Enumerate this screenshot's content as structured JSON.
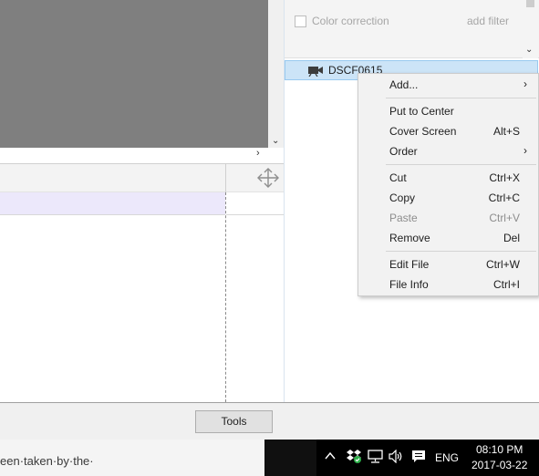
{
  "filters": {
    "items": [
      {
        "label": "Color correction",
        "checked": false
      }
    ],
    "add_filter_label": "add filter"
  },
  "clip": {
    "name": "DSCF0615",
    "icon": "video-camera-icon"
  },
  "context_menu": {
    "items": [
      {
        "label": "Add...",
        "submenu": true
      },
      {
        "label": "Put to Center",
        "shortcut": ""
      },
      {
        "label": "Cover Screen",
        "shortcut": "Alt+S"
      },
      {
        "label": "Order",
        "submenu": true
      },
      {
        "label": "Cut",
        "shortcut": "Ctrl+X"
      },
      {
        "label": "Copy",
        "shortcut": "Ctrl+C"
      },
      {
        "label": "Paste",
        "shortcut": "Ctrl+V",
        "disabled": true
      },
      {
        "label": "Remove",
        "shortcut": "Del"
      },
      {
        "label": "Edit File",
        "shortcut": "Ctrl+W"
      },
      {
        "label": "File Info",
        "shortcut": "Ctrl+I"
      }
    ],
    "submenu_arrow": "›"
  },
  "toolbar": {
    "tools_label": "Tools"
  },
  "document_snippet": "een·taken·by·the·",
  "taskbar": {
    "language": "ENG",
    "time": "08:10 PM",
    "date": "2017-03-22",
    "tray_icons": [
      "chevron-up-icon",
      "dropbox-icon",
      "network-icon",
      "volume-icon",
      "notification-icon"
    ]
  },
  "glyphs": {
    "chevron_down": "⌄",
    "chevron_right": "›"
  },
  "colors": {
    "selection": "#cce4f7",
    "track": "#ece8fb",
    "preview": "#7f7f7f"
  }
}
